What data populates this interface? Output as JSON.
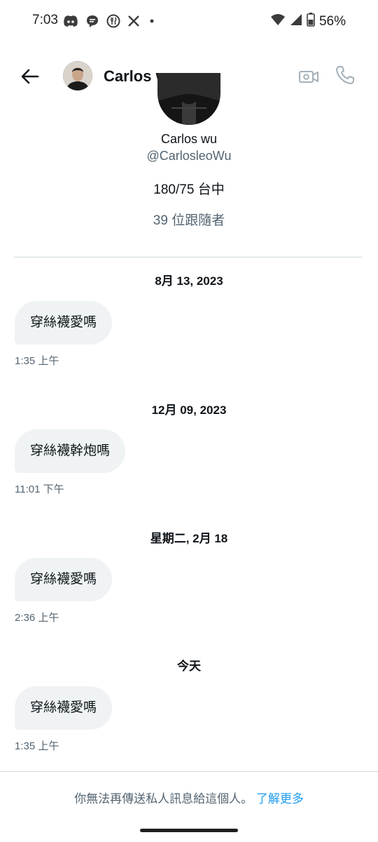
{
  "status_bar": {
    "time": "7:03",
    "battery": "56%",
    "left_icons": [
      "discord-icon",
      "chat-icon",
      "fork-knife-icon",
      "x-icon",
      "dot-icon"
    ],
    "right_icons": [
      "wifi-icon",
      "signal-icon",
      "battery-icon"
    ]
  },
  "header": {
    "name": "Carlos wu"
  },
  "profile": {
    "name": "Carlos wu",
    "handle": "@CarlosleoWu",
    "bio": "180/75 台中",
    "followers": "39 位跟隨者"
  },
  "conversation": [
    {
      "date": "8月 13, 2023",
      "message": "穿絲襪愛嗎",
      "time": "1:35 上午"
    },
    {
      "date": "12月 09, 2023",
      "message": "穿絲襪幹炮嗎",
      "time": "11:01 下午"
    },
    {
      "date": "星期二, 2月 18",
      "message": "穿絲襪愛嗎",
      "time": "2:36 上午"
    },
    {
      "date": "今天",
      "message": "穿絲襪愛嗎",
      "time": "1:35 上午"
    }
  ],
  "footer": {
    "notice": "你無法再傳送私人訊息給這個人。",
    "link": "了解更多"
  },
  "colors": {
    "text_primary": "#0f1419",
    "text_secondary": "#536471",
    "link": "#1d9bf0",
    "bubble": "#eff3f4",
    "divider": "#cfd9de"
  }
}
